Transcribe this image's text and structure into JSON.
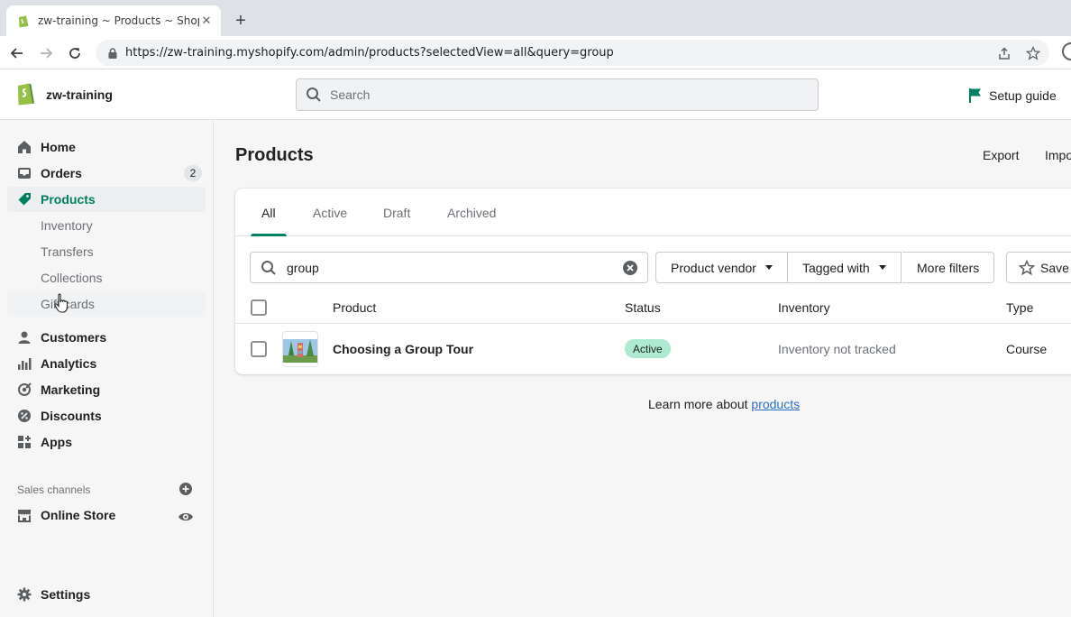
{
  "browser": {
    "tab_title": "zw-training ~ Products ~ Shopify",
    "url": "https://zw-training.myshopify.com/admin/products?selectedView=all&query=group"
  },
  "topbar": {
    "store_name": "zw-training",
    "search_placeholder": "Search",
    "setup_guide": "Setup guide"
  },
  "sidebar": {
    "home": "Home",
    "orders": "Orders",
    "orders_count": "2",
    "products": "Products",
    "sub": [
      "Inventory",
      "Transfers",
      "Collections",
      "Gift cards"
    ],
    "customers": "Customers",
    "analytics": "Analytics",
    "marketing": "Marketing",
    "discounts": "Discounts",
    "apps": "Apps",
    "sales_channels": "Sales channels",
    "online_store": "Online Store",
    "settings": "Settings"
  },
  "page": {
    "title": "Products",
    "export": "Export",
    "import": "Import"
  },
  "tabs": [
    "All",
    "Active",
    "Draft",
    "Archived"
  ],
  "filters": {
    "query": "group",
    "vendor": "Product vendor",
    "tagged": "Tagged with",
    "more": "More filters",
    "save": "Save"
  },
  "table": {
    "headers": [
      "Product",
      "Status",
      "Inventory",
      "Type"
    ],
    "row": {
      "product": "Choosing a Group Tour",
      "status": "Active",
      "inventory": "Inventory not tracked",
      "type": "Course"
    }
  },
  "footer": {
    "learn_prefix": "Learn more about ",
    "learn_link": "products"
  },
  "colors": {
    "accent": "#008060",
    "status_active": "#aee9d1",
    "link": "#2c6ecb"
  }
}
